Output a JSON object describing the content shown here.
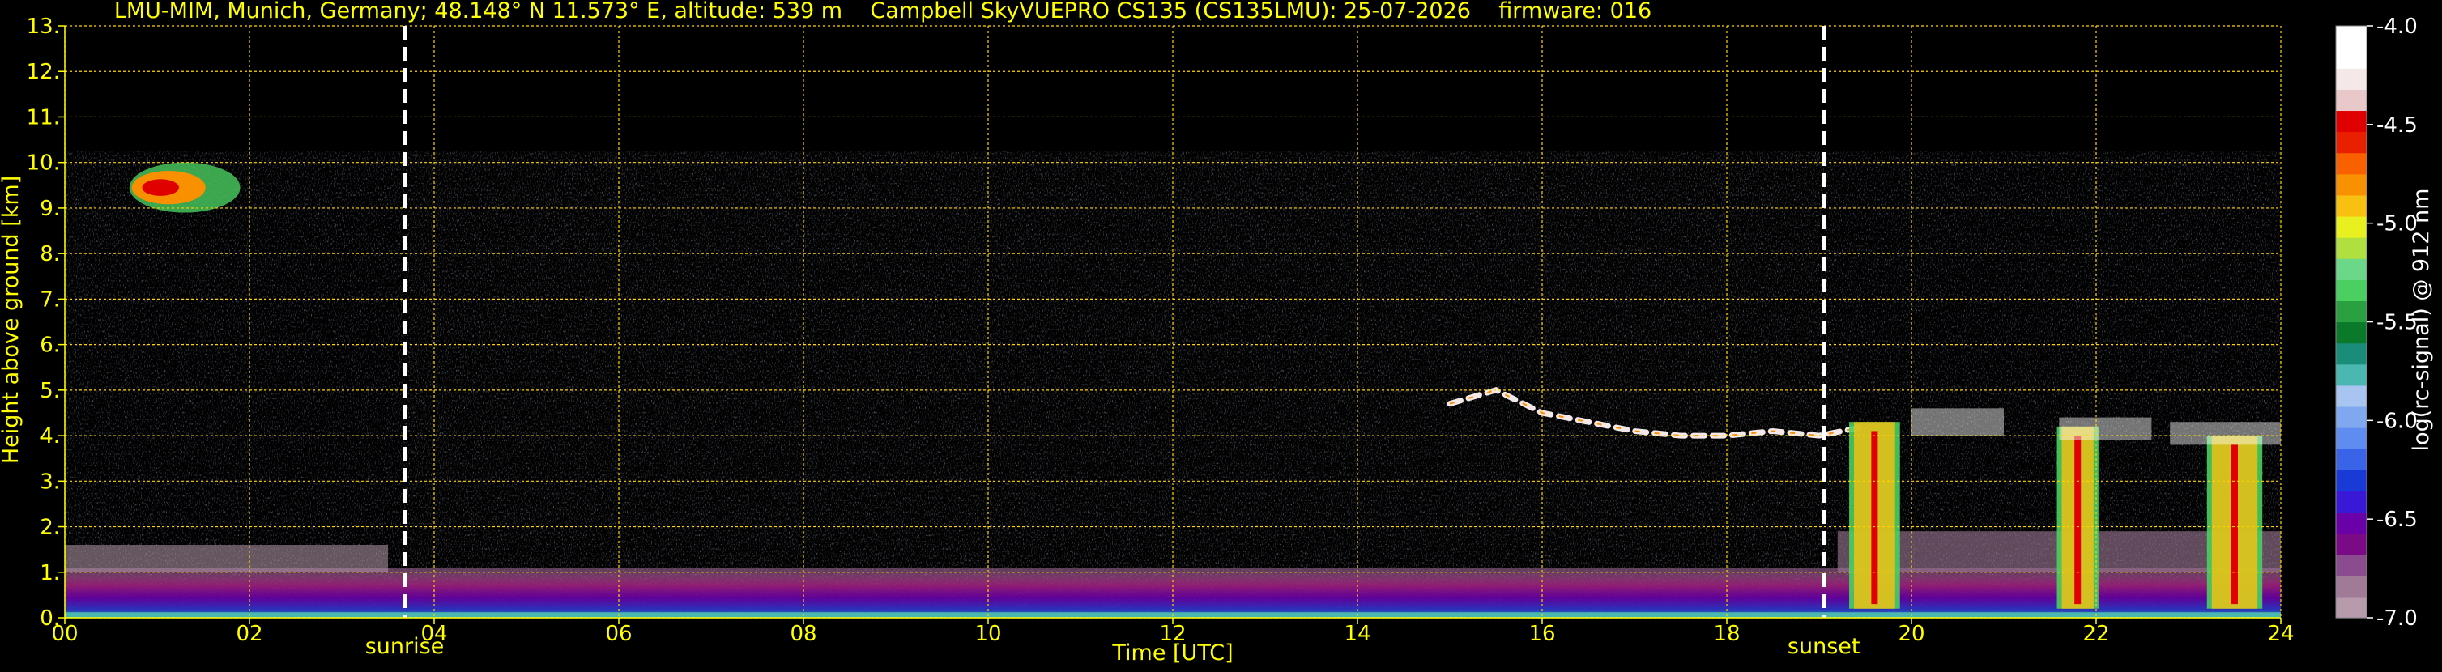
{
  "chart_data": {
    "type": "heatmap",
    "title": "LMU-MIM, Munich, Germany; 48.148° N 11.573° E, altitude: 539 m    Campbell SkyVUEPRO CS135 (CS135LMU): 25-07-2026    firmware: 016",
    "xlabel": "Time [UTC]",
    "ylabel": "Height above ground [km]",
    "xlim": [
      0,
      24
    ],
    "ylim": [
      0,
      13
    ],
    "x_ticks": [
      "00",
      "02",
      "04",
      "06",
      "08",
      "10",
      "12",
      "14",
      "16",
      "18",
      "20",
      "22",
      "24"
    ],
    "y_ticks": [
      "0.",
      "1.",
      "2.",
      "3.",
      "4.",
      "5.",
      "6.",
      "7.",
      "8.",
      "9.",
      "10.",
      "11.",
      "12.",
      "13."
    ],
    "grid": true,
    "data_top_km": 10.25,
    "markers": [
      {
        "label": "sunrise",
        "time": 3.68
      },
      {
        "label": "sunset",
        "time": 19.05
      }
    ],
    "features": [
      {
        "kind": "cirrus",
        "x": [
          0.7,
          1.9
        ],
        "y": [
          8.9,
          10.0
        ]
      },
      {
        "kind": "boundary-layer",
        "x": [
          0,
          24
        ],
        "y": [
          0,
          1.1
        ]
      },
      {
        "kind": "cloud-layer",
        "x": [
          15.0,
          19.5
        ],
        "y": [
          3.9,
          5.0
        ]
      },
      {
        "kind": "convective-cells",
        "x": [
          19.0,
          24.0
        ],
        "y": [
          0.2,
          5.5
        ]
      }
    ],
    "colorbar": {
      "label": "log(rc-signal) @ 912 nm",
      "ticks": [
        "-4.0",
        "-4.5",
        "-5.0",
        "-5.5",
        "-6.0",
        "-6.5",
        "-7.0"
      ],
      "min": -7.0,
      "max": -4.0,
      "colors": [
        "#b79aab",
        "#a07a96",
        "#8b4c8f",
        "#7a0a86",
        "#6a00a8",
        "#3a18d8",
        "#1a3ad8",
        "#3a64e8",
        "#5e8cf0",
        "#80a8f0",
        "#a8c4f0",
        "#4ab8b0",
        "#1a8c7a",
        "#0a7a2a",
        "#2aa040",
        "#4ad060",
        "#6ad888",
        "#b0e040",
        "#e8f020",
        "#f8c010",
        "#f89000",
        "#f86000",
        "#e82000",
        "#e00000",
        "#e8c8c8",
        "#f4e8e8",
        "#ffffff",
        "#ffffff"
      ]
    }
  }
}
